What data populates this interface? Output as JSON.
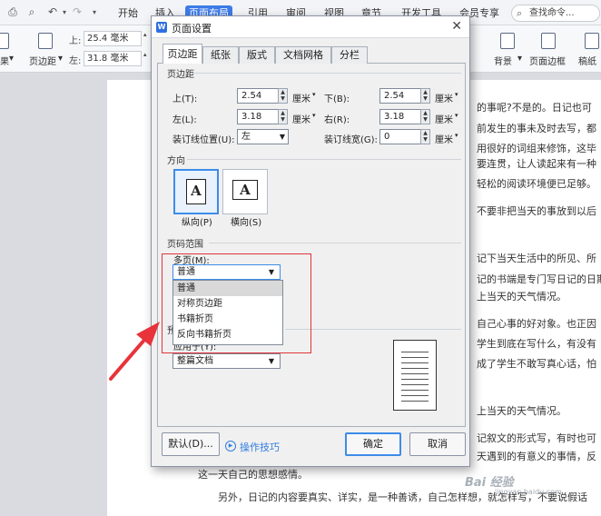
{
  "ribbon": {
    "tabs": [
      "开始",
      "插入",
      "页面布局",
      "引用",
      "审阅",
      "视图",
      "章节",
      "开发工具",
      "会员专享"
    ],
    "active_tab": "页面布局",
    "search_label": "查找命令...",
    "margin_fields": {
      "top_label": "上:",
      "top_value": "25.4 毫米",
      "bottom_label": "左:",
      "bottom_value": "31.8 毫米"
    },
    "margin_button_label": "页边距",
    "left_stub_label": "果",
    "background_label": "背景",
    "page_border_label": "页面边框",
    "paper_sketch_label": "稿纸"
  },
  "document": {
    "right_lines": [
      "的事呢?不是的。日记也可",
      "前发生的事未及时去写，都",
      "用很好的词组来修饰，这毕",
      "要连贯，让人读起来有一种",
      "轻松的阅读环境便已足够。",
      "不要非把当天的事放到以后",
      "记下当天生活中的所见、所",
      "记的书端是专门写日记的日期",
      "上当天的天气情况。",
      "自己心事的好对象。也正因",
      "学生到底在写什么，有没有",
      "成了学生不敢写真心话，怕",
      "上当天的天气情况。",
      "记叙文的形式写，有时也可",
      "天遇到的有意义的事情，反"
    ],
    "bottom_line_1": "这一天自己的思想感情。",
    "bottom_line_2": "另外，日记的内容要真实、详实，是一种善诱，自己怎样想，就怎样写，不要说假话",
    "watermark": "Bai 经验",
    "watermark_url": "jingyan.baidu.com"
  },
  "dialog": {
    "title": "页面设置",
    "tabs": [
      "页边距",
      "纸张",
      "版式",
      "文档网格",
      "分栏"
    ],
    "active_tab": "页边距",
    "margins_section": "页边距",
    "top_label": "上(T):",
    "top_value": "2.54",
    "bottom_label": "下(B):",
    "bottom_value": "2.54",
    "left_label": "左(L):",
    "left_value": "3.18",
    "right_label": "右(R):",
    "right_value": "3.18",
    "unit": "厘米",
    "gutter_pos_label": "装订线位置(U):",
    "gutter_pos_value": "左",
    "gutter_width_label": "装订线宽(G):",
    "gutter_width_value": "0",
    "orientation_section": "方向",
    "portrait_label": "纵向(P)",
    "landscape_label": "横向(S)",
    "page_range_section": "页码范围",
    "multiple_pages_label": "多页(M):",
    "multiple_pages_value": "普通",
    "multiple_pages_options": [
      "普通",
      "对称页边距",
      "书籍折页",
      "反向书籍折页"
    ],
    "preview_section_stub": "预",
    "apply_to_label": "应用于(Y):",
    "apply_to_value": "整篇文档",
    "default_button": "默认(D)...",
    "tips_link": "操作技巧",
    "ok_button": "确定",
    "cancel_button": "取消"
  },
  "colors": {
    "accent": "#3d7be8",
    "highlight_box": "#e0343a",
    "arrow": "#e8333a"
  }
}
